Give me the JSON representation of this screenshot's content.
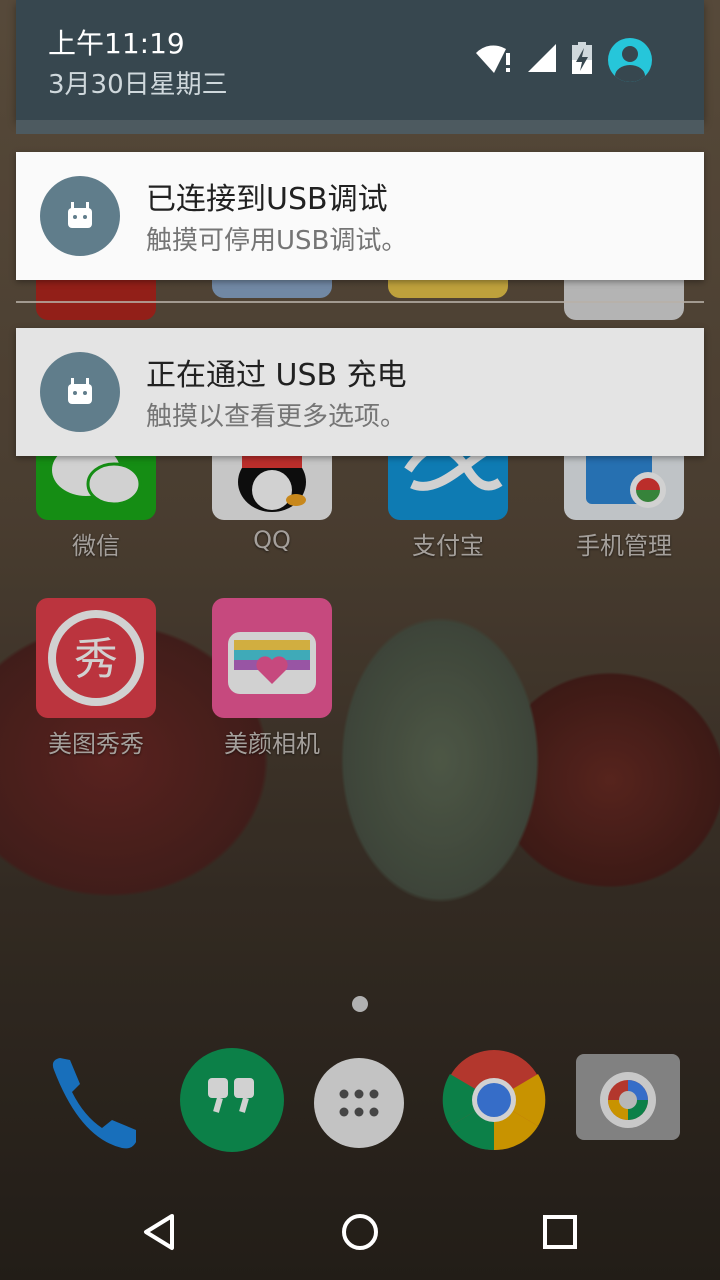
{
  "status_header": {
    "time": "上午11:19",
    "date": "3月30日星期三",
    "accent_color": "#26c6da",
    "icons": [
      "wifi-alert-icon",
      "signal-icon",
      "battery-charging-icon",
      "user-avatar-icon"
    ]
  },
  "notifications": [
    {
      "title": "已连接到USB调试",
      "text": "触摸可停用USB调试。",
      "icon": "android-debug-icon"
    },
    {
      "title": "正在通过 USB 充电",
      "text": "触摸以查看更多选项。",
      "icon": "android-usb-icon"
    }
  ],
  "apps": [
    {
      "label": "微信",
      "icon": "wechat-icon",
      "color": "#1aad19"
    },
    {
      "label": "QQ",
      "icon": "qq-penguin-icon",
      "color": "#f2f2f2"
    },
    {
      "label": "支付宝",
      "icon": "alipay-icon",
      "color": "#1296db"
    },
    {
      "label": "手机管理",
      "icon": "phone-manager-icon",
      "color": "#e9eef2"
    },
    {
      "label": "美图秀秀",
      "icon": "meitu-xiuxiu-icon",
      "color": "#e5404c"
    },
    {
      "label": "美颜相机",
      "icon": "beauty-camera-icon",
      "color": "#f25a9a"
    }
  ],
  "dock": [
    "phone-icon",
    "hangouts-icon",
    "app-drawer-icon",
    "chrome-icon",
    "camera-icon"
  ],
  "navbar": [
    "back-icon",
    "home-icon",
    "recents-icon"
  ]
}
